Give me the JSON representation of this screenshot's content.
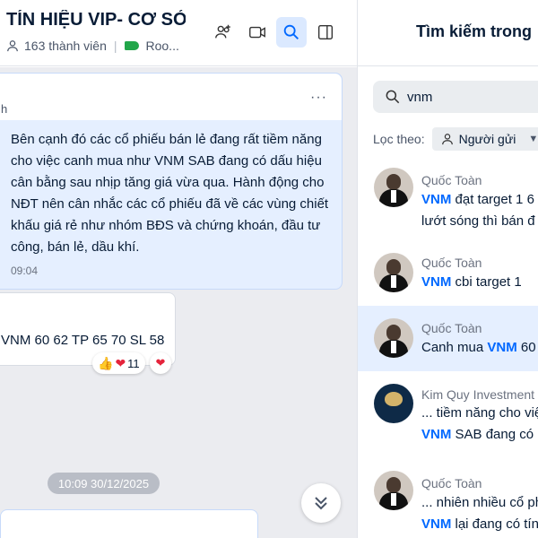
{
  "header": {
    "title": "TÍN HIỆU VIP- CƠ SỞ - ...",
    "members": "163 thành viên",
    "tag": "Roo..."
  },
  "chat": {
    "blue_message": {
      "sender_cut": "h",
      "menu": "···",
      "body": "Bên cạnh đó các cổ phiếu bán lẻ đang rất tiềm năng cho việc canh mua như VNM SAB đang có dấu hiệu cân bằng sau nhịp tăng giá vừa qua. Hành động cho NĐT nên cân nhắc các cổ phiếu đã về các vùng chiết khấu giá rẻ như nhóm BĐS và chứng khoán, đầu tư công, bán lẻ, dầu khí.",
      "time": "09:04"
    },
    "white_message": {
      "body": "VNM 60 62 TP 65 70 SL 58",
      "reaction_count": "11"
    },
    "timestamp": "10:09 30/12/2025"
  },
  "search_panel": {
    "title": "Tìm kiếm trong",
    "query": "vnm",
    "filter_label": "Lọc theo:",
    "filter_value": "Người gửi",
    "highlight": "VNM",
    "results": [
      {
        "name": "Quốc Toàn",
        "before": "",
        "after": " đạt target 1 6",
        "line2": "lướt sóng thì bán đ"
      },
      {
        "name": "Quốc Toàn",
        "before": "",
        "after": " cbi target 1",
        "line2": ""
      },
      {
        "name": "Quốc Toàn",
        "before": "Canh mua ",
        "after": " 60",
        "line2": ""
      },
      {
        "name": "Kim Quy Investment",
        "before": "",
        "after": " SAB đang có",
        "line2": "... tiềm năng cho việ"
      },
      {
        "name": "Quốc Toàn",
        "before": "",
        "after": " lại đang có tín",
        "line2": "... nhiên nhiều cổ ph"
      }
    ]
  },
  "colors": {
    "accent": "#0068ff",
    "active_bg": "#e5efff",
    "chat_bg": "#ebecf0"
  }
}
